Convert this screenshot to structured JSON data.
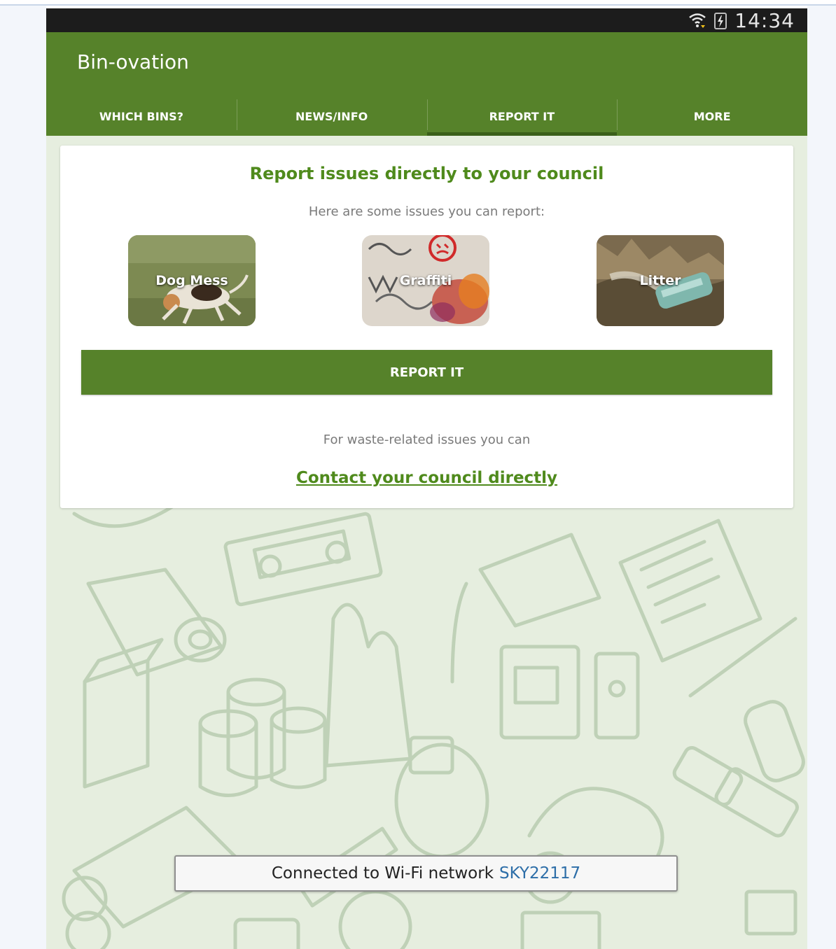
{
  "status_bar": {
    "time": "14:34",
    "icons": [
      "wifi-icon",
      "battery-charging-icon"
    ]
  },
  "app": {
    "title": "Bin-ovation"
  },
  "tabs": [
    {
      "label": "WHICH BINS?",
      "active": false
    },
    {
      "label": "NEWS/INFO",
      "active": false
    },
    {
      "label": "REPORT IT",
      "active": true
    },
    {
      "label": "MORE",
      "active": false
    }
  ],
  "card": {
    "title": "Report issues directly to your council",
    "subtitle": "Here are some issues you can report:",
    "issues": [
      {
        "label": "Dog Mess"
      },
      {
        "label": "Graffiti"
      },
      {
        "label": "Litter"
      }
    ],
    "report_button": "REPORT IT",
    "waste_text": "For waste-related issues you can",
    "contact_link": "Contact your council directly"
  },
  "toast": {
    "message": "Connected to Wi-Fi network",
    "network": "SKY22117"
  },
  "colors": {
    "primary": "#56822a",
    "accent_text": "#4f8a1c",
    "background": "#e6eedf"
  }
}
